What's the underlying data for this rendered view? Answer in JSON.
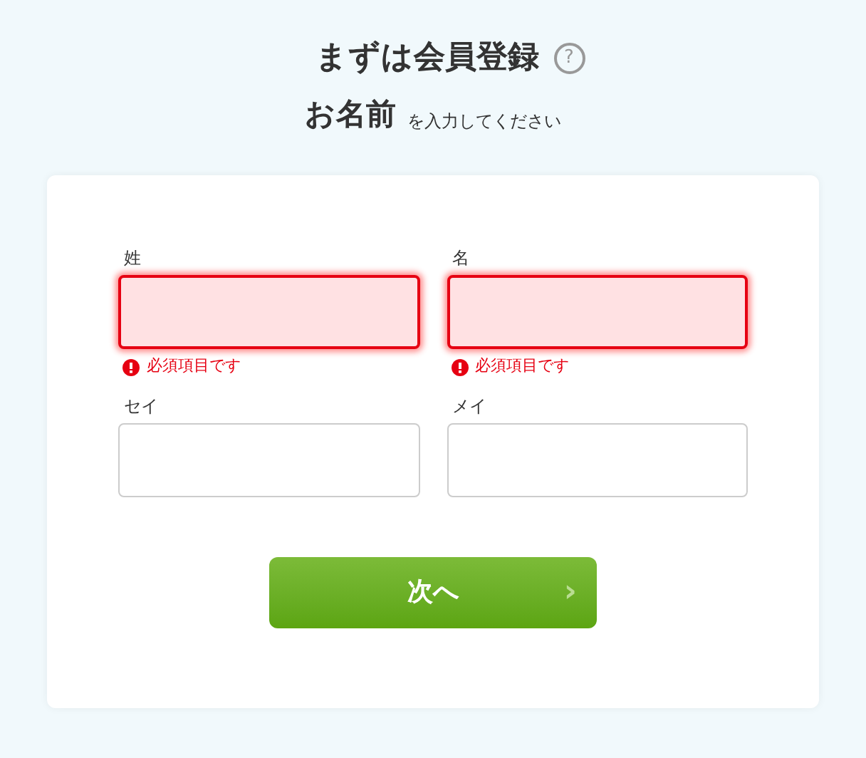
{
  "heading": {
    "title": "まずは会員登録",
    "help_icon": "?"
  },
  "subheading": {
    "emphasis": "お名前",
    "text": "を入力してください"
  },
  "fields": [
    {
      "label": "姓",
      "error": true,
      "message": "必須項目です"
    },
    {
      "label": "名",
      "error": true,
      "message": "必須項目です"
    },
    {
      "label": "セイ",
      "error": false
    },
    {
      "label": "メイ",
      "error": false
    }
  ],
  "next_button": {
    "label": "次へ",
    "arrow": "›"
  }
}
